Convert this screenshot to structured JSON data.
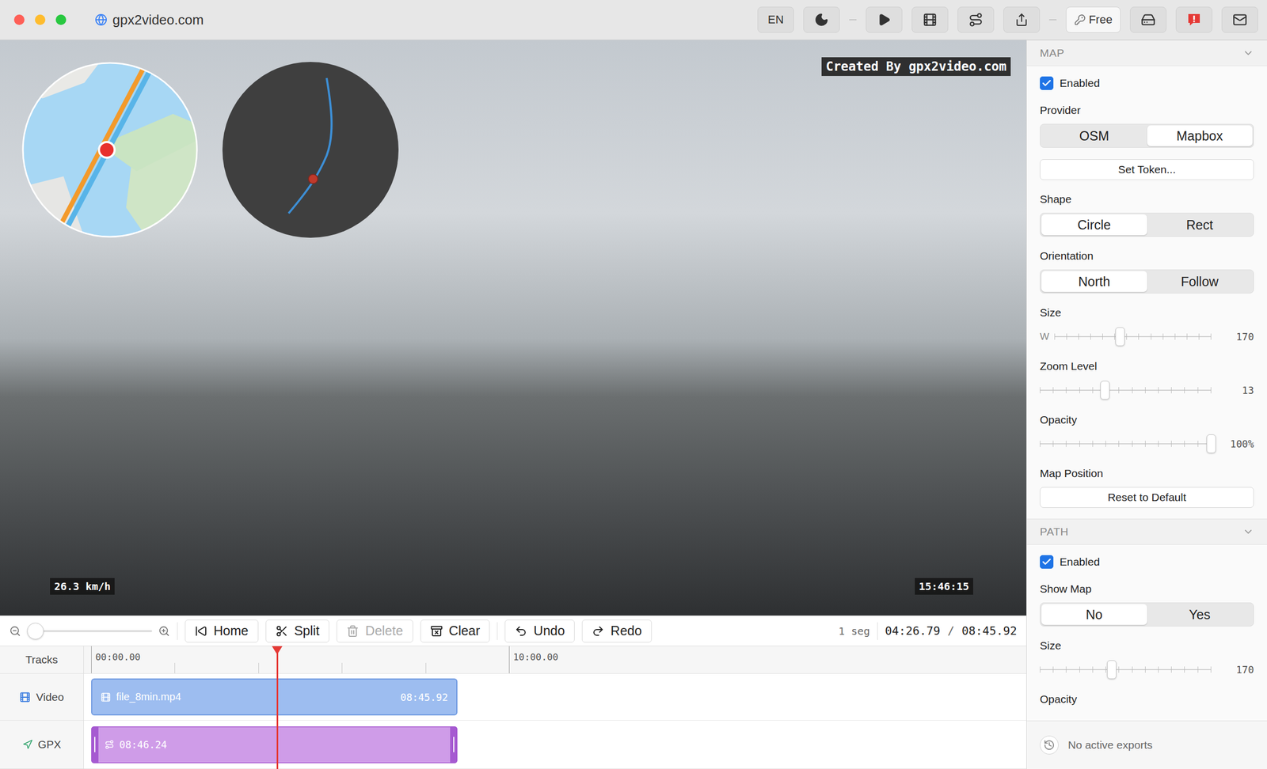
{
  "window": {
    "title": "gpx2video.com"
  },
  "toolbar": {
    "language": "EN",
    "plan": "Free"
  },
  "preview": {
    "watermark": "Created By gpx2video.com",
    "speed": "26.3 km/h",
    "clock": "15:46:15"
  },
  "timeline_toolbar": {
    "zoom": {
      "level": 0
    },
    "buttons": [
      {
        "label": "Home",
        "disabled": false
      },
      {
        "label": "Split",
        "disabled": false
      },
      {
        "label": "Delete",
        "disabled": true
      },
      {
        "label": "Clear",
        "disabled": false
      },
      {
        "label": "Undo",
        "disabled": false
      },
      {
        "label": "Redo",
        "disabled": false
      }
    ],
    "segments": "1 seg",
    "position": "04:26.79",
    "separator": "/",
    "duration": "08:45.92"
  },
  "timeline": {
    "header": "Tracks",
    "ticks": [
      {
        "label": "00:00.00"
      },
      {
        "label": "10:00.00"
      }
    ],
    "tracks": [
      {
        "name": "Video",
        "kind": "video",
        "clip": {
          "label": "file_8min.mp4",
          "length": "08:45.92"
        }
      },
      {
        "name": "GPX",
        "kind": "gpx",
        "clip": {
          "label": "",
          "length": "08:46.24"
        }
      }
    ]
  },
  "sidebar": {
    "sections": [
      {
        "title": "MAP",
        "expanded": true,
        "fields": [
          {
            "kind": "checkbox",
            "label": "Enabled",
            "checked": true
          },
          {
            "kind": "segmented",
            "label": "Provider",
            "options": [
              {
                "label": "OSM",
                "selected": false
              },
              {
                "label": "Mapbox",
                "selected": true
              }
            ]
          },
          {
            "kind": "button",
            "label": "",
            "text": "Set Token..."
          },
          {
            "kind": "segmented",
            "label": "Shape",
            "options": [
              {
                "label": "Circle",
                "selected": true
              },
              {
                "label": "Rect",
                "selected": false
              }
            ]
          },
          {
            "kind": "segmented",
            "label": "Orientation",
            "options": [
              {
                "label": "North",
                "selected": true
              },
              {
                "label": "Follow",
                "selected": false
              }
            ]
          },
          {
            "kind": "slider",
            "label": "Size",
            "prefix": "W",
            "level": 0.42,
            "reading": "170"
          },
          {
            "kind": "slider",
            "label": "Zoom Level",
            "prefix": "",
            "level": 0.38,
            "reading": "13"
          },
          {
            "kind": "slider",
            "label": "Opacity",
            "prefix": "",
            "level": 1,
            "reading": "100%"
          },
          {
            "kind": "button",
            "label": "Map Position",
            "text": "Reset to Default"
          }
        ]
      },
      {
        "title": "PATH",
        "expanded": true,
        "fields": [
          {
            "kind": "checkbox",
            "label": "Enabled",
            "checked": true
          },
          {
            "kind": "segmented",
            "label": "Show Map",
            "options": [
              {
                "label": "No",
                "selected": true
              },
              {
                "label": "Yes",
                "selected": false
              }
            ]
          },
          {
            "kind": "slider",
            "label": "Size",
            "prefix": "",
            "level": 0.42,
            "reading": "170"
          },
          {
            "kind": "label",
            "label": "Opacity"
          }
        ]
      }
    ],
    "exports": "No active exports"
  }
}
